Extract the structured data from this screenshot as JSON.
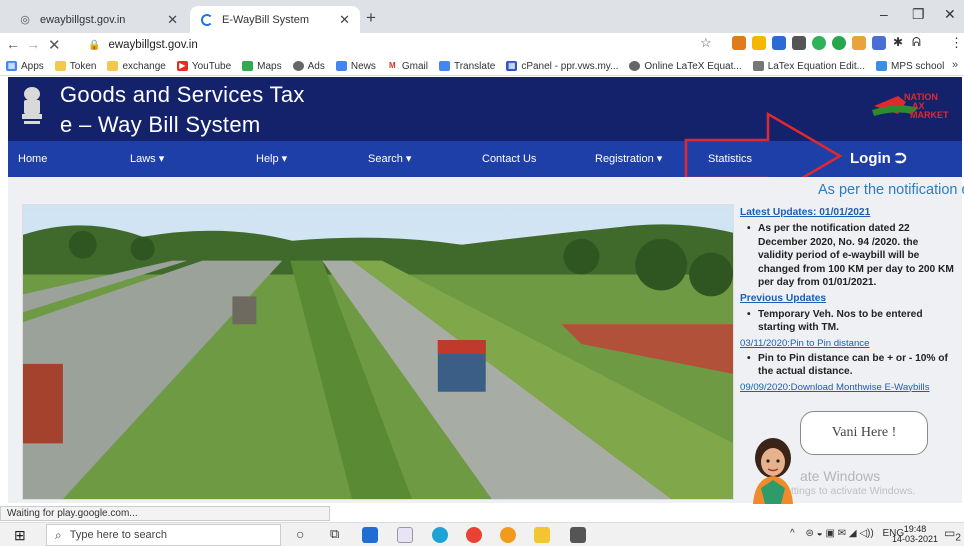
{
  "browser": {
    "tabs": [
      {
        "title": "ewaybillgst.gov.in",
        "active": false
      },
      {
        "title": "E-WayBill System",
        "active": true
      }
    ],
    "new_tab": "+",
    "url": "ewaybillgst.gov.in",
    "window_controls": {
      "minimize": "–",
      "restore": "❐",
      "close": "✕"
    },
    "bookmarks": [
      "Apps",
      "Token",
      "exchange",
      "YouTube",
      "Maps",
      "Ads",
      "News",
      "Gmail",
      "Translate",
      "cPanel - ppr.vws.my...",
      "Online LaTeX Equat...",
      "LaTex Equation Edit...",
      "MPS school"
    ],
    "bookmarks_more": "»"
  },
  "site": {
    "title_line1": "Goods and Services Tax",
    "title_line2": "e – Way Bill System",
    "logo_text": [
      "NATION",
      "AX",
      "MARKET"
    ],
    "nav": [
      {
        "label": "Home"
      },
      {
        "label": "Laws ▾"
      },
      {
        "label": "Help ▾"
      },
      {
        "label": "Search ▾"
      },
      {
        "label": "Contact Us"
      },
      {
        "label": "Registration ▾"
      },
      {
        "label": "Statistics"
      }
    ],
    "login_label": "Login",
    "login_icon": "⮊",
    "marquee": "As per the notification d",
    "colors": {
      "header": "#13226b",
      "nav": "#1f3fa8",
      "annotation_arrow": "#e0282e",
      "link": "#1a5fb4"
    }
  },
  "updates": {
    "latest_heading": "Latest Updates: 01/01/2021",
    "latest_item": "As per the notification dated 22 December 2020, No. 94 /2020. the validity period of e-waybill will be changed from 100 KM per day to 200 KM per day from 01/01/2021.",
    "previous_heading": "Previous Updates",
    "previous_item": "Temporary Veh. Nos to be entered starting with TM.",
    "link1": "03/11/2020:Pin to Pin distance",
    "link1_item": "Pin to Pin distance can be + or - 10% of the actual distance.",
    "link2": "09/09/2020:Download Monthwise E-Waybills"
  },
  "assistant": {
    "label": "Vani Here !"
  },
  "watermark": {
    "line1": "ate Windows",
    "line2": "ettings to activate Windows."
  },
  "status_text": "Waiting for play.google.com...",
  "taskbar": {
    "search_placeholder": "Type here to search",
    "tray_lang": "ENG",
    "time": "19:48",
    "date": "14-03-2021",
    "notification_count": "2"
  }
}
